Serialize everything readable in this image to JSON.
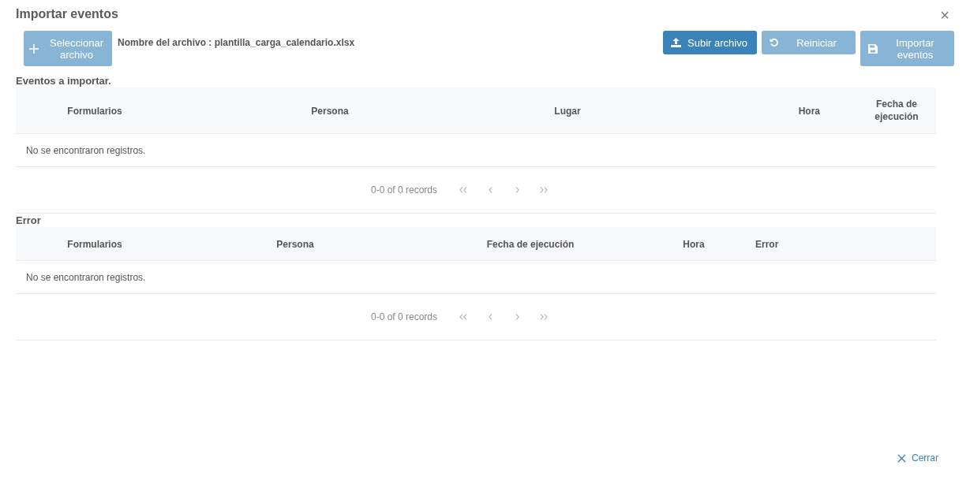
{
  "dialog": {
    "title": "Importar eventos",
    "close_icon": "×"
  },
  "toolbar": {
    "select_button": {
      "label": "Seleccionar archivo",
      "kind": "plus",
      "disabled": true
    },
    "file_name": "Nombre del archivo : plantilla_carga_calendario.xlsx",
    "buttons": [
      {
        "label": "Subir archivo",
        "kind": "upload",
        "disabled": false
      },
      {
        "label": "Reiniciar",
        "kind": "undo",
        "disabled": true
      },
      {
        "label": "Importar eventos",
        "kind": "save",
        "disabled": true
      }
    ]
  },
  "tables": [
    {
      "title": "Eventos a importar.",
      "kind": "events",
      "columns": [
        "Formularios",
        "Persona",
        "Lugar",
        "Hora",
        "Fecha de ejecución"
      ],
      "empty_message": "No se encontraron registros.",
      "pagination": {
        "summary": "0-0 of 0 records"
      }
    },
    {
      "title": "Error",
      "kind": "errors",
      "columns": [
        "Formularios",
        "Persona",
        "Fecha de ejecución",
        "Hora",
        "Error"
      ],
      "empty_message": "No se encontraron registros.",
      "pagination": {
        "summary": "0-0 of 0 records"
      }
    }
  ],
  "footer": {
    "close_button": {
      "label": "Cerrar"
    }
  }
}
